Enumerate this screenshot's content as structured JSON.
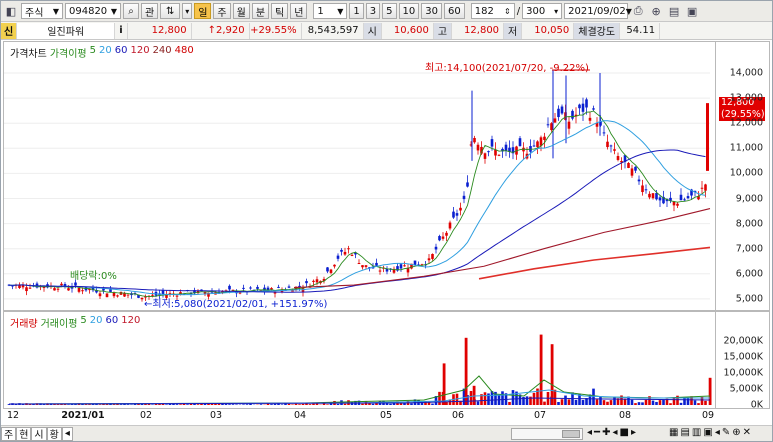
{
  "toolbar": {
    "market_type": "주식",
    "stock_code": "094820",
    "btn_favorites": "관",
    "period_buttons": [
      "일",
      "주",
      "월",
      "분",
      "틱",
      "년"
    ],
    "unit_select": "1",
    "quick_buttons": [
      "1",
      "3",
      "5",
      "10",
      "30",
      "60"
    ],
    "count_value": "182",
    "slash": "/",
    "total_value": "300",
    "date_value": "2021/09/02"
  },
  "info": {
    "new_tag": "신",
    "stock_name": "일진파워",
    "info_btn": "i",
    "price": "12,800",
    "change": "↑2,920",
    "change_pct": "+29.55%",
    "volume": "8,543,597",
    "open_label": "시",
    "open_value": "10,600",
    "high_label": "고",
    "high_value": "12,800",
    "low_label": "저",
    "low_value": "10,050",
    "strength_label": "체결강도",
    "strength_value": "54.11"
  },
  "price_legend": {
    "title": "가격차트",
    "ma_title": "가격이평",
    "ma_values": [
      "5",
      "20",
      "60",
      "120",
      "240",
      "480"
    ],
    "ma_colors": [
      "#2a8a1e",
      "#2f9fe0",
      "#1a1ab8",
      "#c0182a",
      "#8a1f1f",
      "#d00000"
    ]
  },
  "volume_legend": {
    "title": "거래량",
    "ma_title": "거래이평",
    "ma_values": [
      "5",
      "20",
      "60",
      "120"
    ]
  },
  "annotations": {
    "high": "최고:14,100(2021/07/20, -9.22%)",
    "low": "←최저:5,080(2021/02/01, +151.97%)",
    "dividend": "배당락:0%",
    "current_price": "12,800",
    "current_pct": "(29.55%)"
  },
  "colors": {
    "up": "#e00000",
    "down": "#0a1fd0",
    "ma5": "#2a8a1e",
    "ma20": "#2f9fe0",
    "ma60": "#1a1ab8",
    "ma120": "#a0182a",
    "ma240": "#e0302a"
  },
  "price_axis": [
    "14,000",
    "13,000",
    "12,000",
    "11,000",
    "10,000",
    "9,000",
    "8,000",
    "7,000",
    "6,000",
    "5,000"
  ],
  "volume_axis": [
    "20,000K",
    "15,000K",
    "10,000K",
    "5,000K",
    "0K"
  ],
  "x_axis": [
    "12",
    "2021/01",
    "02",
    "03",
    "04",
    "05",
    "06",
    "07",
    "08",
    "09"
  ],
  "bottom_tabs": [
    "주",
    "현",
    "시",
    "황"
  ]
}
